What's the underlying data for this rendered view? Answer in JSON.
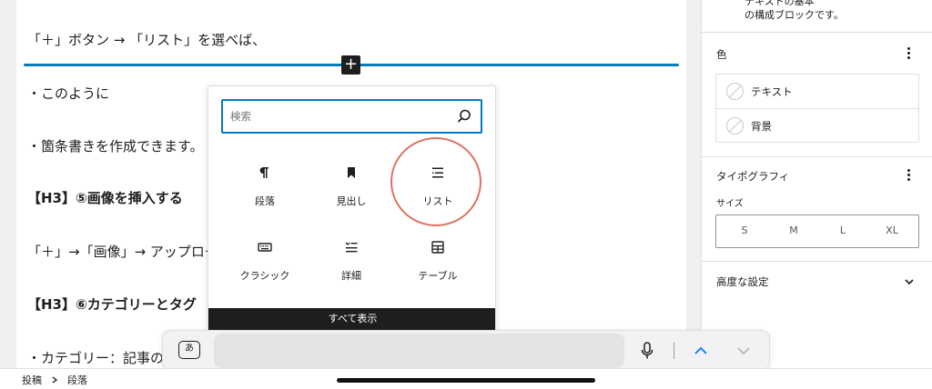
{
  "editor": {
    "blocks": [
      "「＋」ボタン → 「リスト」を選べば、",
      "・このように",
      "・箇条書きを作成できます。",
      "【H3】⑤画像を挿入する",
      "「＋」→「画像」→ アップロード",
      "【H3】⑥カテゴリーとタグ",
      "・カテゴリー：記事の"
    ],
    "inserter_icon": "plus-icon"
  },
  "inserter": {
    "search_placeholder": "検索",
    "blocks": [
      {
        "label": "段落",
        "icon": "paragraph-icon"
      },
      {
        "label": "見出し",
        "icon": "heading-bookmark-icon"
      },
      {
        "label": "リスト",
        "icon": "list-icon"
      },
      {
        "label": "クラシック",
        "icon": "keyboard-icon"
      },
      {
        "label": "詳細",
        "icon": "details-icon"
      },
      {
        "label": "テーブル",
        "icon": "table-icon"
      }
    ],
    "show_all": "すべて表示",
    "highlight_color": "#d9634f"
  },
  "sidebar": {
    "top_text": [
      "テキストの基本",
      "の構成ブロックです。"
    ],
    "color": {
      "title": "色",
      "items": [
        "テキスト",
        "背景"
      ]
    },
    "typography": {
      "title": "タイポグラフィ",
      "size_label": "サイズ",
      "sizes": [
        "S",
        "M",
        "L",
        "XL"
      ]
    },
    "advanced": {
      "title": "高度な設定"
    }
  },
  "keyboard_bar": {
    "input_mode": "あ"
  },
  "breadcrumb": [
    "投稿",
    "段落"
  ],
  "colors": {
    "accent": "#007cba",
    "dark": "#1e1e1e"
  }
}
